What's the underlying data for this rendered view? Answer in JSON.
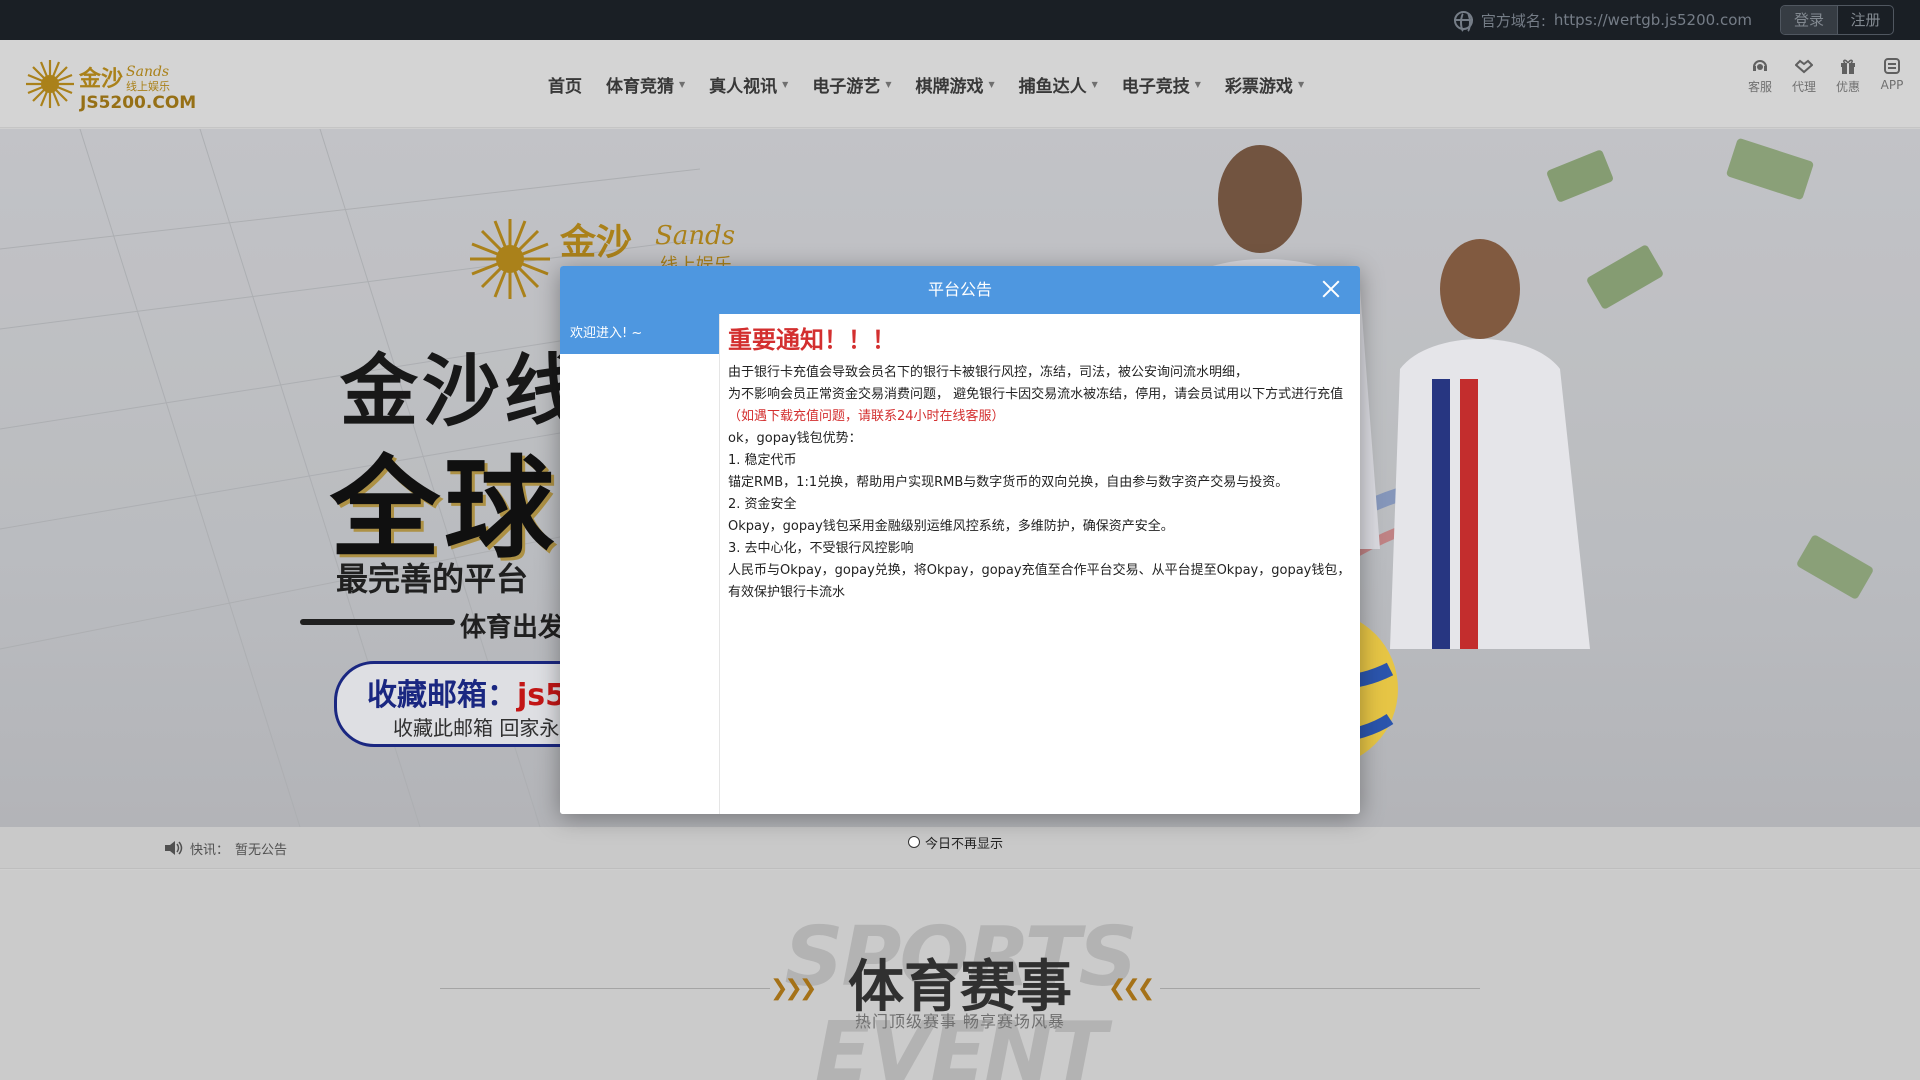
{
  "topbar": {
    "domain_label": "官方域名:",
    "domain_url": "https://wertgb.js5200.com",
    "login_label": "登录",
    "register_label": "注册"
  },
  "header": {
    "logo_text": "JS5200.COM",
    "nav": [
      {
        "label": "首页",
        "has_dropdown": false
      },
      {
        "label": "体育竞猜",
        "has_dropdown": true
      },
      {
        "label": "真人视讯",
        "has_dropdown": true
      },
      {
        "label": "电子游艺",
        "has_dropdown": true
      },
      {
        "label": "棋牌游戏",
        "has_dropdown": true
      },
      {
        "label": "捕鱼达人",
        "has_dropdown": true
      },
      {
        "label": "电子竞技",
        "has_dropdown": true
      },
      {
        "label": "彩票游戏",
        "has_dropdown": true
      }
    ],
    "tools": [
      {
        "label": "客服",
        "icon": "headset-icon"
      },
      {
        "label": "代理",
        "icon": "handshake-icon"
      },
      {
        "label": "优惠",
        "icon": "gift-icon"
      },
      {
        "label": "APP",
        "icon": "app-icon"
      }
    ]
  },
  "banner": {
    "title1": "金沙线",
    "title2": "全球",
    "subtitle": "最完善的平台",
    "sports": "体育出发",
    "box_label": "收藏邮箱：",
    "box_value": "js52",
    "box_sub": "收藏此邮箱 回家永远"
  },
  "ticker": {
    "label": "快讯：",
    "text": "暂无公告"
  },
  "section": {
    "watermark": "SPORTS EVENT",
    "title": "体育赛事",
    "subtitle": "热门顶级赛事 畅享赛场风暴"
  },
  "modal": {
    "title": "平台公告",
    "side_items": [
      "欢迎进入! ~"
    ],
    "notice_title": "重要通知！！！",
    "lines": [
      "由于银行卡充值会导致会员名下的银行卡被银行风控，冻结，司法，被公安询问流水明细，",
      "为不影响会员正常资金交易消费问题， 避免银行卡因交易流水被冻结，停用，请会员试用以下方式进行充值"
    ],
    "contact_note": "（如遇下载充值问题，请联系24小时在线客服）",
    "lines2": [
      "ok，gopay钱包优势：",
      "1. 稳定代币",
      "锚定RMB，1:1兑换，帮助用户实现RMB与数字货币的双向兑换，自由参与数字资产交易与投资。",
      "2. 资金安全",
      "Okpay，gopay钱包采用金融级别运维风控系统，多维防护，确保资产安全。",
      "3. 去中心化，不受银行风控影响",
      "人民币与Okpay，gopay兑换，将Okpay，gopay充值至合作平台交易、从平台提至Okpay，gopay钱包，有效保护银行卡流水"
    ],
    "no_show_label": "今日不再显示"
  },
  "colors": {
    "modal_header": "#4e97e0",
    "notice_red": "#d32f2f",
    "topbar": "#1c2128"
  }
}
